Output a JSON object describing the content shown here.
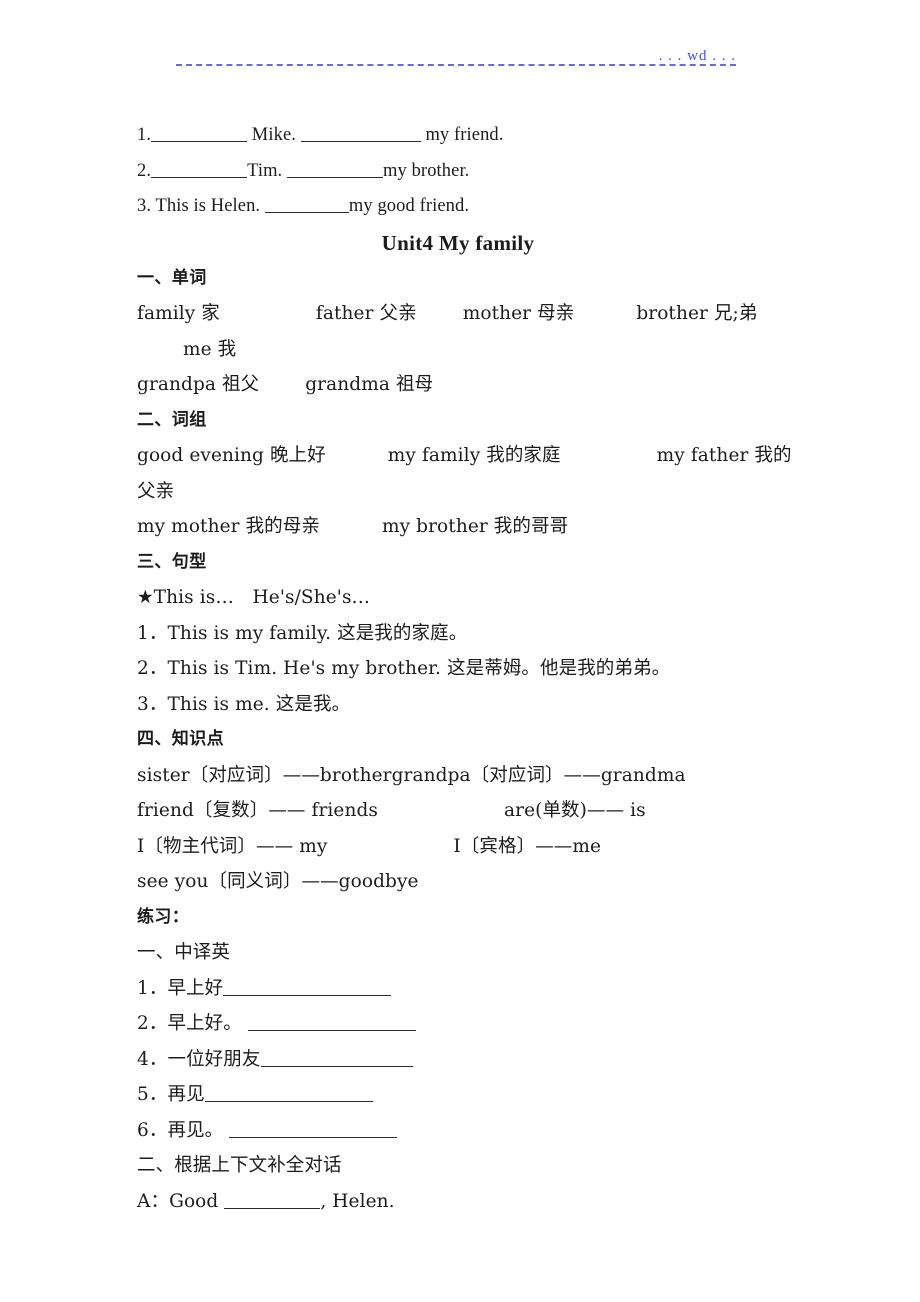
{
  "header": {
    "watermark": ". . . wd . . ."
  },
  "intro_exercises": [
    {
      "num": "1.",
      "seg1": " Mike. ",
      "seg2": " my friend."
    },
    {
      "num": "2.",
      "seg1": "Tim. ",
      "seg2": "my brother."
    },
    {
      "num": "3.",
      "seg1": " This is Helen. ",
      "seg2": "my good friend."
    }
  ],
  "title": "Unit4 My family",
  "sections": {
    "words": {
      "heading": "一、单词",
      "lines": [
        {
          "items": [
            "family 家",
            "father 父亲",
            "mother 母亲",
            "brother 兄;弟",
            "me 我"
          ]
        },
        {
          "items": [
            "grandpa 祖父",
            "grandma 祖母"
          ]
        }
      ]
    },
    "phrases": {
      "heading": "二、词组",
      "lines": [
        {
          "items": [
            "good evening 晚上好",
            "my family 我的家庭",
            "my father 我的父亲"
          ]
        },
        {
          "items": [
            "my mother 我的母亲",
            "my brother 我的哥哥"
          ]
        }
      ]
    },
    "patterns": {
      "heading": "三、句型",
      "star_line": "★This is…　He's/She's…",
      "items": [
        {
          "num": "1．",
          "text": "This is my family. 这是我的家庭。"
        },
        {
          "num": "2．",
          "text": "This is Tim. He's my brother. 这是蒂姆。他是我的弟弟。"
        },
        {
          "num": "3．",
          "text": "This is me. 这是我。"
        }
      ]
    },
    "knowledge": {
      "heading": "四、知识点",
      "lines": [
        {
          "left": "sister〔对应词〕——brothergrandpa〔对应词〕——grandma",
          "right": ""
        },
        {
          "left": "friend〔复数〕—— friends",
          "right": "are(单数)—— is"
        },
        {
          "left": "I〔物主代词〕—— my",
          "right": "I〔宾格〕——me"
        },
        {
          "left": "see you〔同义词〕——goodbye",
          "right": ""
        }
      ]
    },
    "practice": {
      "heading": "练习：",
      "part1": {
        "heading": "一、中译英",
        "items": [
          {
            "num": "1．",
            "text": "早上好"
          },
          {
            "num": "2．",
            "text": "早上好。 "
          },
          {
            "num": "4．",
            "text": "一位好朋友"
          },
          {
            "num": "5．",
            "text": "再见"
          },
          {
            "num": "6．",
            "text": "再见。 "
          }
        ]
      },
      "part2": {
        "heading": "二、根据上下文补全对话",
        "dialogue": [
          {
            "speaker": "A：",
            "before": "Good ",
            "after": ", Helen."
          }
        ]
      }
    }
  }
}
